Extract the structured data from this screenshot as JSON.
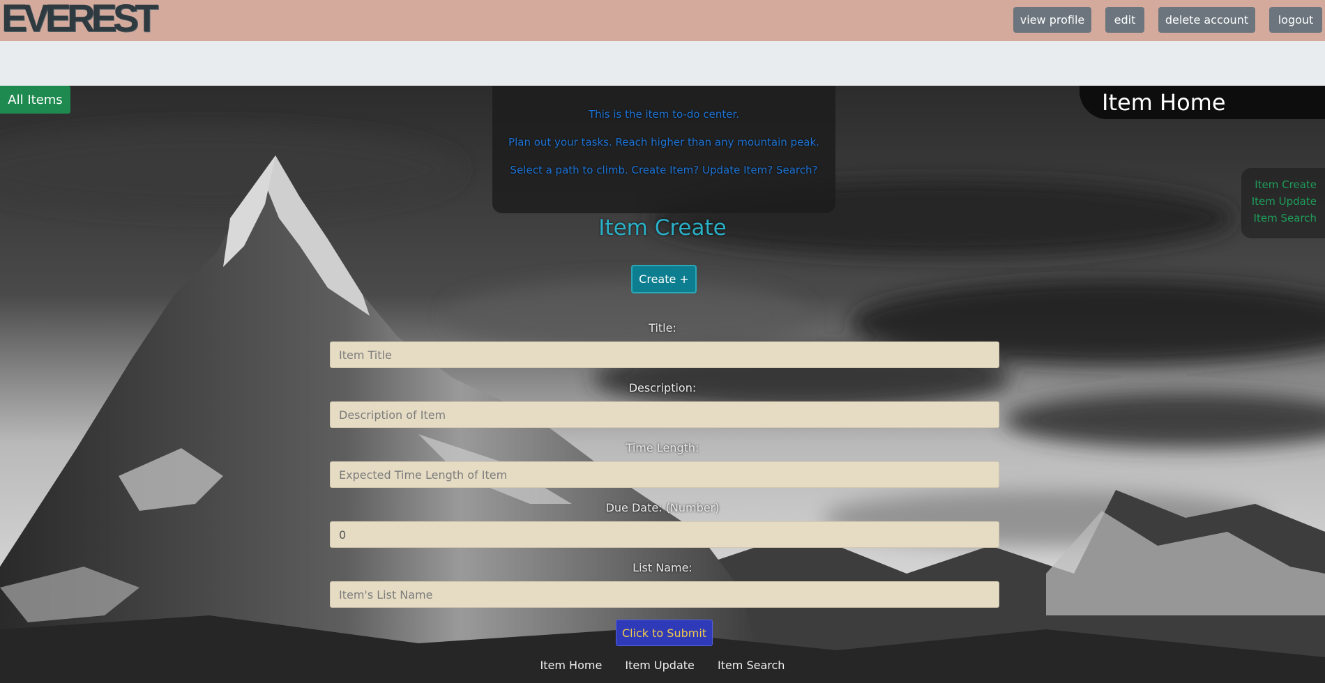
{
  "navbar": {
    "logo": "EVEREST",
    "buttons": [
      {
        "label": "view profile"
      },
      {
        "label": "edit"
      },
      {
        "label": "delete account"
      },
      {
        "label": "logout"
      }
    ]
  },
  "all_items_button": "All Items",
  "intro": {
    "line1": "This is the item to-do center.",
    "line2": "Plan out your tasks. Reach higher than any mountain peak.",
    "line3": "Select a path to climb. Create Item? Update Item? Search?"
  },
  "page_heading": "Item Home",
  "side_nav": [
    "Item Create",
    "Item Update",
    "Item Search"
  ],
  "create": {
    "title": "Item Create",
    "toggle_label": "Create +"
  },
  "form": {
    "title": {
      "label": "Title:",
      "placeholder": "Item Title"
    },
    "description": {
      "label": "Description:",
      "placeholder": "Description of Item"
    },
    "time_length": {
      "label": "Time Length:",
      "placeholder": "Expected Time Length of Item"
    },
    "due_date": {
      "label": "Due Date: (Number)",
      "value": "0"
    },
    "list_name": {
      "label": "List Name:",
      "placeholder": "Item's List Name"
    },
    "submit_label": "Click to Submit"
  },
  "footer_nav": [
    "Item Home",
    "Item Update",
    "Item Search"
  ]
}
